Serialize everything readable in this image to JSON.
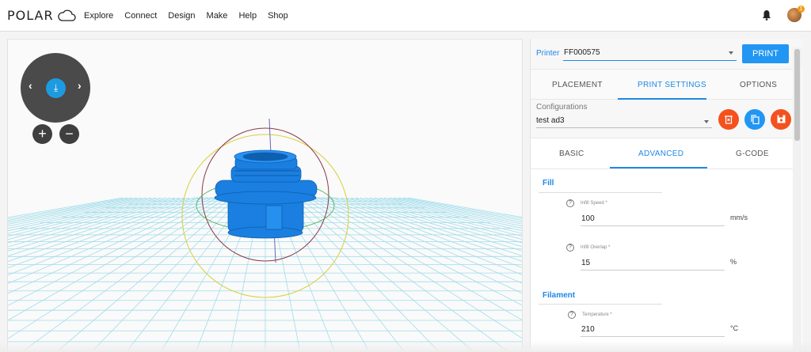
{
  "brand": {
    "name": "POLAR"
  },
  "nav": [
    "Explore",
    "Connect",
    "Design",
    "Make",
    "Help",
    "Shop"
  ],
  "notifications": {
    "count": "1"
  },
  "viewer": {
    "zoom_in": "+",
    "zoom_out": "−",
    "colors": {
      "grid": "#9fdcea",
      "model": "#1a7fe0",
      "ring_outer": "#d8cf3a",
      "ring_inner": "#b02a2a"
    }
  },
  "printer": {
    "label": "Printer",
    "value": "FF000575",
    "print_button": "PRINT"
  },
  "main_tabs": [
    "PLACEMENT",
    "PRINT SETTINGS",
    "OPTIONS"
  ],
  "configurations": {
    "label": "Configurations",
    "value": "test ad3"
  },
  "settings_tabs": [
    "BASIC",
    "ADVANCED",
    "G-CODE"
  ],
  "sections": {
    "fill": {
      "title": "Fill",
      "infill_speed": {
        "label": "Infill Speed *",
        "value": "100",
        "unit": "mm/s"
      },
      "infill_overlap": {
        "label": "Infill Overlap *",
        "value": "15",
        "unit": "%"
      }
    },
    "filament": {
      "title": "Filament",
      "temperature": {
        "label": "Temperature *",
        "value": "210",
        "unit": "°C"
      }
    }
  },
  "accent_colors": {
    "primary": "#1e88e5",
    "delete": "#f4511e",
    "copy": "#2196f3",
    "save": "#f4511e"
  }
}
